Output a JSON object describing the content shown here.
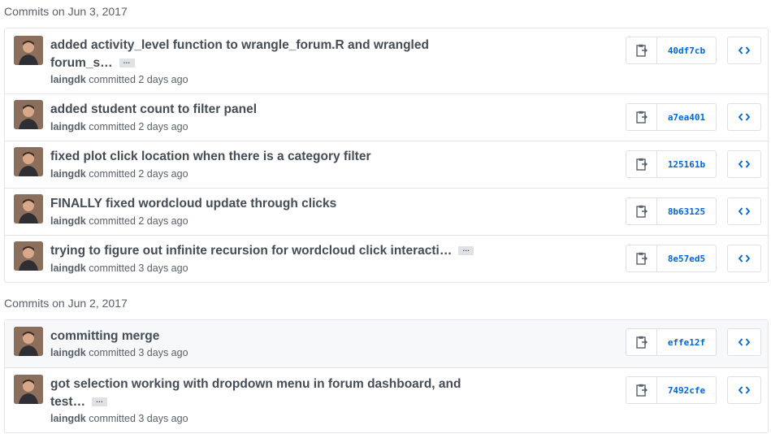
{
  "groups": [
    {
      "header": "Commits on Jun 3, 2017",
      "commits": [
        {
          "title_line1": "added activity_level function to wrangle_forum.R and wrangled",
          "title_line2": "forum_s…",
          "author": "laingdk",
          "committed": "committed 2 days ago",
          "sha": "40df7cb"
        },
        {
          "title_line1": "added student count to filter panel",
          "title_line2": "",
          "author": "laingdk",
          "committed": "committed 2 days ago",
          "sha": "a7ea401"
        },
        {
          "title_line1": "fixed plot click location when there is a category filter",
          "title_line2": "",
          "author": "laingdk",
          "committed": "committed 2 days ago",
          "sha": "125161b"
        },
        {
          "title_line1": "FINALLY fixed wordcloud update through clicks",
          "title_line2": "",
          "author": "laingdk",
          "committed": "committed 2 days ago",
          "sha": "8b63125"
        },
        {
          "title_line1": "trying to figure out infinite recursion for wordcloud click interacti…",
          "title_line2": "",
          "author": "laingdk",
          "committed": "committed 3 days ago",
          "sha": "8e57ed5"
        }
      ]
    },
    {
      "header": "Commits on Jun 2, 2017",
      "commits": [
        {
          "title_line1": "committing merge",
          "title_line2": "",
          "author": "laingdk",
          "committed": "committed 3 days ago",
          "sha": "effe12f"
        },
        {
          "title_line1": "got selection working with dropdown menu in forum dashboard, and",
          "title_line2": "test…",
          "author": "laingdk",
          "committed": "committed 3 days ago",
          "sha": "7492cfe"
        }
      ]
    }
  ],
  "ellipsis_label": "…",
  "icons": {
    "copy": "clipboard-icon",
    "browse": "code-icon"
  },
  "colors": {
    "sha_link": "#0366d6",
    "row_highlight": "#f6f8fa",
    "border": "#e1e4e8"
  }
}
